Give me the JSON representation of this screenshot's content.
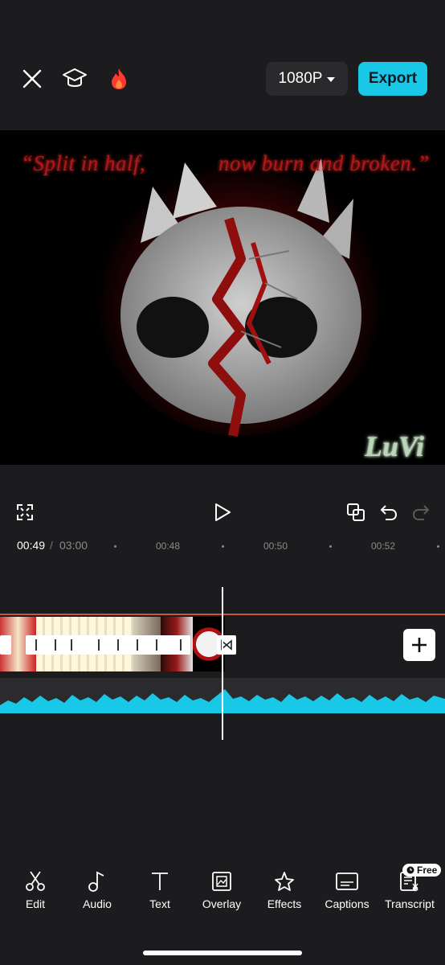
{
  "top_bar": {
    "resolution": "1080P",
    "export_label": "Export"
  },
  "preview": {
    "quote_left": "“Split in half,",
    "quote_right": "now burn and broken.”",
    "signature": "LuVi"
  },
  "timeline": {
    "current_time": "00:49",
    "separator": "/",
    "total_time": "03:00",
    "ticks": [
      "00:48",
      "00:50",
      "00:52"
    ]
  },
  "toolbar": {
    "items": [
      {
        "label": "Edit",
        "icon": "scissors-icon"
      },
      {
        "label": "Audio",
        "icon": "music-note-icon"
      },
      {
        "label": "Text",
        "icon": "text-icon"
      },
      {
        "label": "Overlay",
        "icon": "overlay-icon"
      },
      {
        "label": "Effects",
        "icon": "effects-star-icon"
      },
      {
        "label": "Captions",
        "icon": "captions-icon"
      },
      {
        "label": "Transcript",
        "icon": "transcript-icon"
      }
    ],
    "free_badge": "Free"
  },
  "colors": {
    "accent": "#19c8e6",
    "background": "#1c1c1e",
    "track_line": "#c9573d",
    "waveform": "#19c8e6"
  }
}
